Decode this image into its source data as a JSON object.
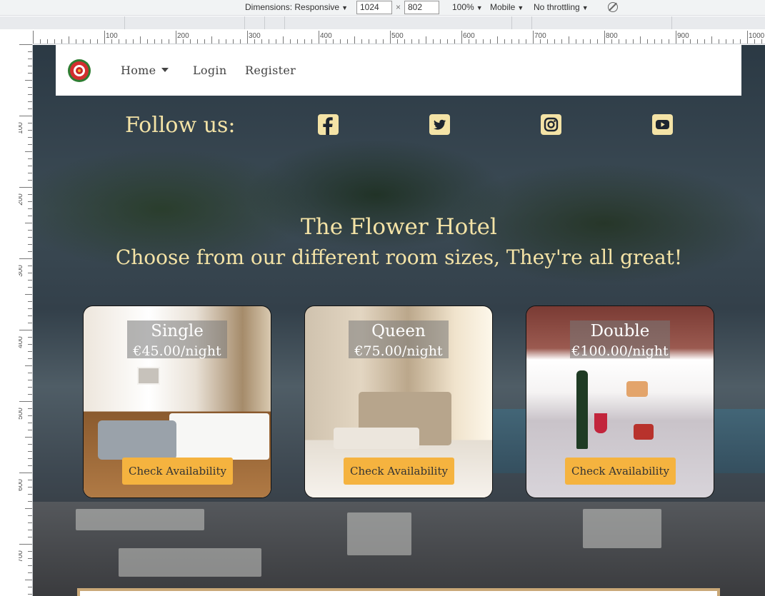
{
  "devtools": {
    "dimensions_label": "Dimensions: Responsive",
    "width": "1024",
    "height": "802",
    "times": "×",
    "zoom": "100%",
    "device_type": "Mobile",
    "throttling": "No throttling",
    "ruler_h": [
      "100",
      "200",
      "300",
      "400",
      "500",
      "600",
      "700",
      "800",
      "900",
      "1000"
    ],
    "ruler_v": [
      "100",
      "200",
      "300",
      "400",
      "500",
      "600",
      "700"
    ]
  },
  "navbar": {
    "logo_icon": "rose-logo-icon",
    "items": [
      {
        "label": "Home",
        "has_dropdown": true
      },
      {
        "label": "Login"
      },
      {
        "label": "Register"
      }
    ]
  },
  "social": {
    "follow_label": "Follow us:",
    "icons": [
      "facebook-icon",
      "twitter-icon",
      "instagram-icon",
      "youtube-icon"
    ],
    "color": "#f4e3a6"
  },
  "hero": {
    "title": "The Flower Hotel",
    "subtitle": "Choose from our different room sizes, They're all great!"
  },
  "rooms": [
    {
      "name": "Single",
      "price": "€45.00/night",
      "button": "Check Availability"
    },
    {
      "name": "Queen",
      "price": "€75.00/night",
      "button": "Check Availability"
    },
    {
      "name": "Double",
      "price": "€100.00/night",
      "button": "Check Availability"
    }
  ],
  "colors": {
    "accent_text": "#f4e3a6",
    "button": "#f5b33f"
  }
}
